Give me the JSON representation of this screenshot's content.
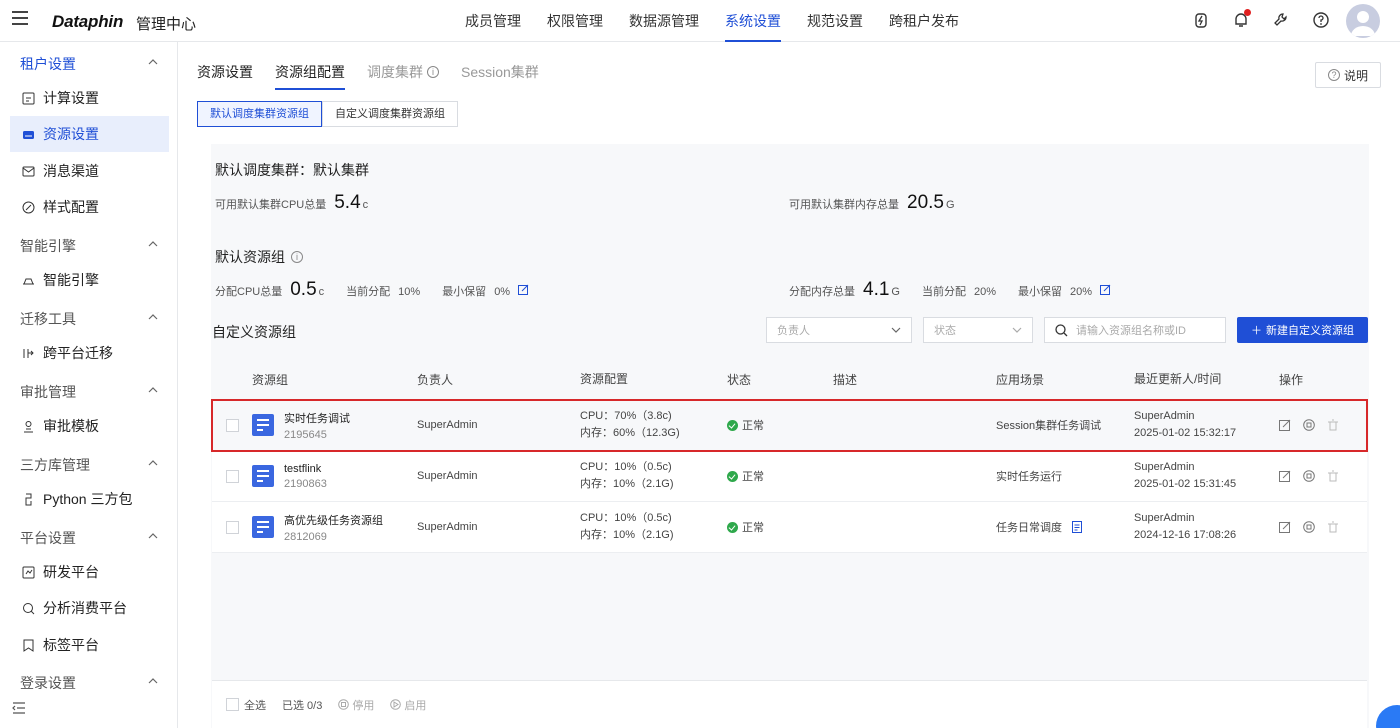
{
  "header": {
    "logo": "Dataphin",
    "app_title": "管理中心",
    "nav": [
      {
        "label": "成员管理",
        "active": false
      },
      {
        "label": "权限管理",
        "active": false
      },
      {
        "label": "数据源管理",
        "active": false
      },
      {
        "label": "系统设置",
        "active": true
      },
      {
        "label": "规范设置",
        "active": false
      },
      {
        "label": "跨租户发布",
        "active": false
      }
    ]
  },
  "sidebar": {
    "groups": [
      {
        "label": "租户设置",
        "active": true
      },
      {
        "label": "智能引擎"
      },
      {
        "label": "迁移工具"
      },
      {
        "label": "审批管理"
      },
      {
        "label": "三方库管理"
      },
      {
        "label": "平台设置"
      },
      {
        "label": "登录设置"
      }
    ],
    "items": [
      {
        "label": "计算设置",
        "icon": "compute-icon"
      },
      {
        "label": "资源设置",
        "icon": "resource-icon",
        "active": true
      },
      {
        "label": "消息渠道",
        "icon": "mail-icon"
      },
      {
        "label": "样式配置",
        "icon": "style-icon"
      },
      {
        "label": "智能引擎",
        "icon": "engine-icon"
      },
      {
        "label": "跨平台迁移",
        "icon": "migrate-icon"
      },
      {
        "label": "审批模板",
        "icon": "approval-icon"
      },
      {
        "label": "Python 三方包",
        "icon": "python-icon"
      },
      {
        "label": "研发平台",
        "icon": "dev-icon"
      },
      {
        "label": "分析消费平台",
        "icon": "analysis-icon"
      },
      {
        "label": "标签平台",
        "icon": "tag-icon"
      }
    ]
  },
  "tabs": [
    {
      "label": "资源设置"
    },
    {
      "label": "资源组配置",
      "active": true
    },
    {
      "label": "调度集群",
      "disabled": true
    },
    {
      "label": "Session集群",
      "disabled": true
    }
  ],
  "help_label": "说明",
  "segment": {
    "default": "默认调度集群资源组",
    "custom": "自定义调度集群资源组"
  },
  "cluster": {
    "title": "默认调度集群：默认集群",
    "cpu_label": "可用默认集群CPU总量",
    "cpu_value": "5.4",
    "cpu_unit": "c",
    "mem_label": "可用默认集群内存总量",
    "mem_value": "20.5",
    "mem_unit": "G"
  },
  "default_group": {
    "title": "默认资源组",
    "cpu_label": "分配CPU总量",
    "cpu_value": "0.5",
    "cpu_unit": "c",
    "cpu_cur_label": "当前分配",
    "cpu_cur": "10%",
    "cpu_min_label": "最小保留",
    "cpu_min": "0%",
    "mem_label": "分配内存总量",
    "mem_value": "4.1",
    "mem_unit": "G",
    "mem_cur_label": "当前分配",
    "mem_cur": "20%",
    "mem_min_label": "最小保留",
    "mem_min": "20%"
  },
  "custom": {
    "title": "自定义资源组",
    "owner_placeholder": "负责人",
    "status_placeholder": "状态",
    "search_placeholder": "请输入资源组名称或ID",
    "new_button": "新建自定义资源组"
  },
  "table": {
    "headers": [
      "资源组",
      "负责人",
      "资源配置",
      "状态",
      "描述",
      "应用场景",
      "最近更新人/时间",
      "操作"
    ],
    "rows": [
      {
        "name": "实时任务调试",
        "id": "2195645",
        "owner": "SuperAdmin",
        "cpu": "CPU：70%（3.8c)",
        "mem": "内存：60%（12.3G)",
        "status": "正常",
        "desc": "",
        "scene": "Session集群任务调试",
        "updater": "SuperAdmin",
        "time": "2025-01-02 15:32:17",
        "highlight": true
      },
      {
        "name": "testflink",
        "id": "2190863",
        "owner": "SuperAdmin",
        "cpu": "CPU：10%（0.5c)",
        "mem": "内存：10%（2.1G)",
        "status": "正常",
        "desc": "",
        "scene": "实时任务运行",
        "updater": "SuperAdmin",
        "time": "2025-01-02 15:31:45"
      },
      {
        "name": "高优先级任务资源组",
        "id": "2812069",
        "owner": "SuperAdmin",
        "cpu": "CPU：10%（0.5c)",
        "mem": "内存：10%（2.1G)",
        "status": "正常",
        "desc": "",
        "scene": "任务日常调度",
        "updater": "SuperAdmin",
        "time": "2024-12-16 17:08:26"
      }
    ]
  },
  "footer": {
    "select_all": "全选",
    "selected": "已选 0/3",
    "disable": "停用",
    "enable": "启用"
  }
}
